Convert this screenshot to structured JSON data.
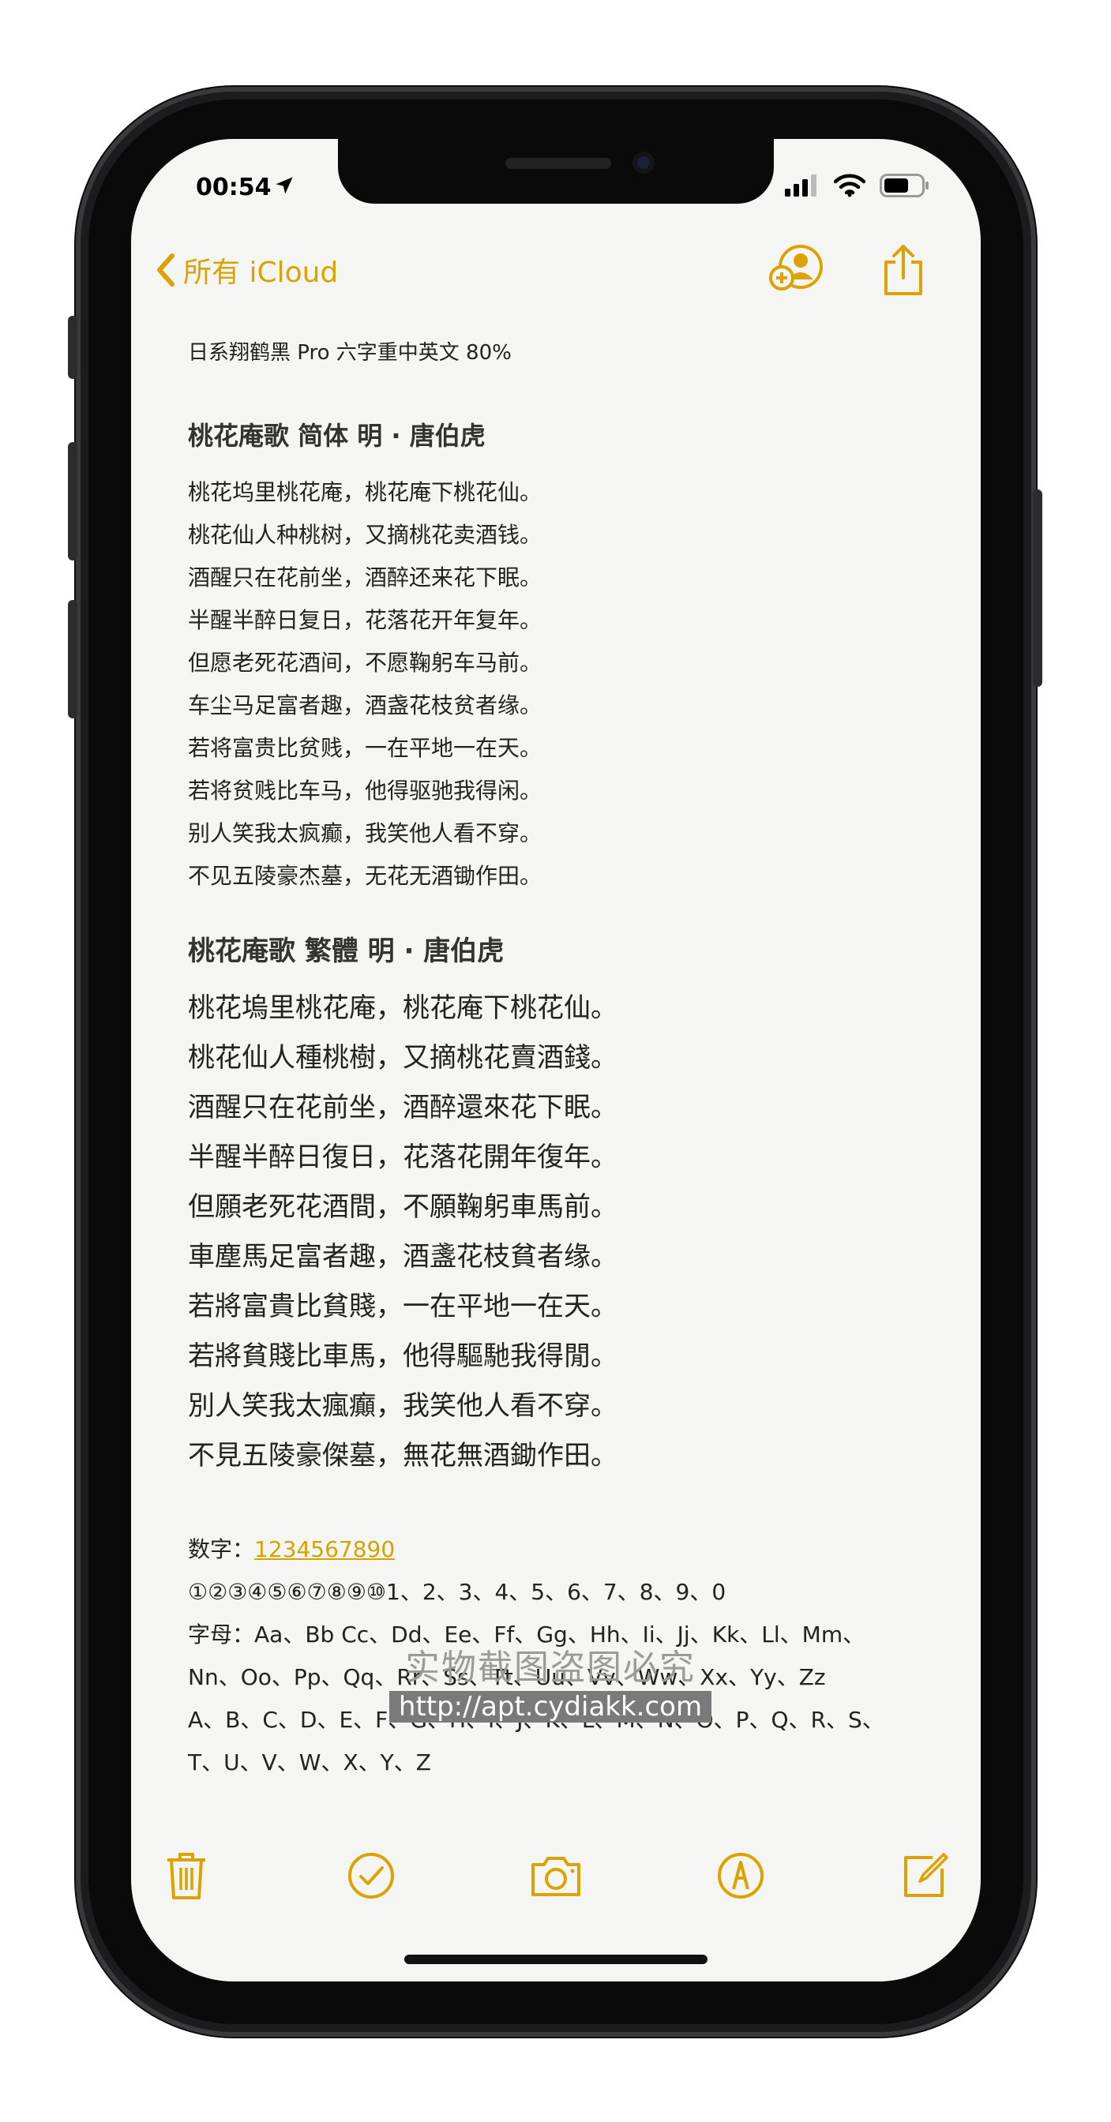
{
  "status_bar": {
    "time": "00:54"
  },
  "nav": {
    "back_label": "所有 iCloud",
    "icons": [
      "add-person-icon",
      "share-icon"
    ]
  },
  "note": {
    "font_note": "日系翔鹤黑 Pro 六字重中英文 80%",
    "poem_simplified": {
      "title": "桃花庵歌  简体   明 · 唐伯虎",
      "lines": [
        "桃花坞里桃花庵，桃花庵下桃花仙。",
        "桃花仙人种桃树，又摘桃花卖酒钱。",
        "酒醒只在花前坐，酒醉还来花下眠。",
        "半醒半醉日复日，花落花开年复年。",
        "但愿老死花酒间，不愿鞠躬车马前。",
        "车尘马足富者趣，酒盏花枝贫者缘。",
        "若将富贵比贫贱，一在平地一在天。",
        "若将贫贱比车马，他得驱驰我得闲。",
        "别人笑我太疯癫，我笑他人看不穿。",
        "不见五陵豪杰墓，无花无酒锄作田。"
      ]
    },
    "poem_traditional": {
      "title": "桃花庵歌  繁體      明 · 唐伯虎",
      "lines": [
        "桃花塢里桃花庵，桃花庵下桃花仙。",
        "桃花仙人種桃樹，又摘桃花賣酒錢。",
        "酒醒只在花前坐，酒醉還來花下眠。",
        "半醒半醉日復日，花落花開年復年。",
        "但願老死花酒間，不願鞠躬車馬前。",
        "車塵馬足富者趣，酒盞花枝貧者缘。",
        "若將富貴比貧賤，一在平地一在天。",
        "若將貧賤比車馬，他得驅馳我得閒。",
        "別人笑我太瘋癲，我笑他人看不穿。",
        "不見五陵豪傑墓，無花無酒鋤作田。"
      ]
    },
    "digits_label": "数字：",
    "digits_value": "1234567890",
    "circled_numbers": "①②③④⑤⑥⑦⑧⑨⑩1、2、3、4、5、6、7、8、9、0",
    "letters_line1": "字母：Aa、Bb Cc、Dd、Ee、Ff、Gg、Hh、Ii、Jj、Kk、Ll、Mm、",
    "letters_line2": "Nn、Oo、Pp、Qq、Rr、Ss、Tt、Uu、Vv、Ww、Xx、Yy、Zz",
    "letters_line3": "A、B、C、D、E、F、G、H、I、J、K、L、M、N、O、P、Q、R、S、",
    "letters_line4": "T、U、V、W、X、Y、Z"
  },
  "watermark": {
    "text": "实物截图盗图必究",
    "url": "http://apt.cydiakk.com"
  },
  "toolbar": {
    "icons": [
      "trash-icon",
      "checklist-icon",
      "camera-icon",
      "markup-icon",
      "compose-icon"
    ]
  },
  "colors": {
    "accent": "#dba200",
    "screen_bg": "#f5f5f3",
    "frame": "#1c1c1e"
  }
}
